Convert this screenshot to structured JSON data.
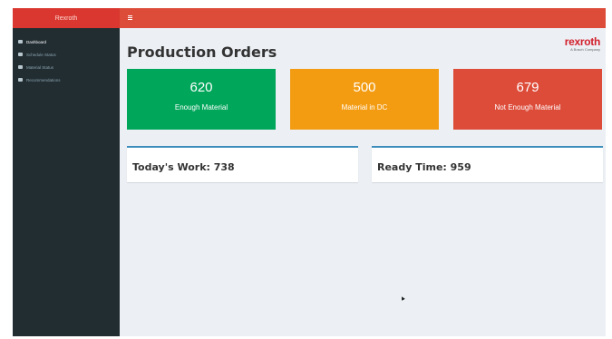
{
  "sidebar": {
    "brand": "Rexroth",
    "items": [
      {
        "label": "Dashboard",
        "icon": "dashboard-icon",
        "active": true
      },
      {
        "label": "Schedule Status",
        "icon": "table-icon"
      },
      {
        "label": "Material Status",
        "icon": "table-icon"
      },
      {
        "label": "Recommendations",
        "icon": "table-icon"
      }
    ]
  },
  "topbar": {
    "menu_icon": "hamburger-icon"
  },
  "main": {
    "title": "Production Orders",
    "logo": {
      "word": "rexroth",
      "sub": "A Bosch Company"
    },
    "boxes": [
      {
        "value": "620",
        "label": "Enough Material",
        "color": "#00a65a"
      },
      {
        "value": "500",
        "label": "Material in DC",
        "color": "#f39c12"
      },
      {
        "value": "679",
        "label": "Not Enough Material",
        "color": "#dd4b39"
      }
    ],
    "todays_work": "Today's Work: 738",
    "ready_time": "Ready Time: 959"
  },
  "colors": {
    "header": "#dd4b39",
    "sidebar": "#222d32",
    "card_border": "#3c8dbc"
  }
}
